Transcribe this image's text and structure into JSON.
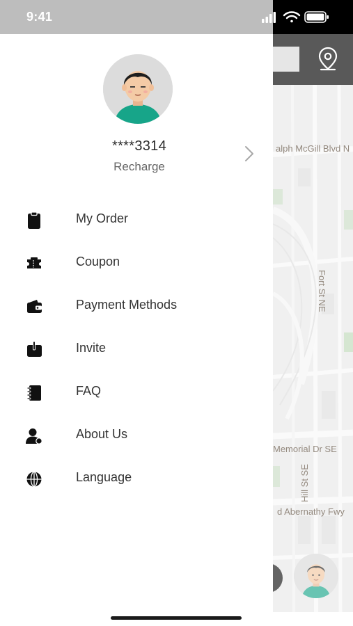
{
  "status_bar": {
    "time": "9:41"
  },
  "profile": {
    "phone_masked": "****3314",
    "recharge_label": "Recharge"
  },
  "menu": [
    {
      "label": "My Order",
      "icon": "clipboard-icon"
    },
    {
      "label": "Coupon",
      "icon": "coupon-icon"
    },
    {
      "label": "Payment Methods",
      "icon": "wallet-icon"
    },
    {
      "label": "Invite",
      "icon": "invite-icon"
    },
    {
      "label": "FAQ",
      "icon": "notebook-icon"
    },
    {
      "label": "About Us",
      "icon": "user-icon"
    },
    {
      "label": "Language",
      "icon": "globe-icon"
    }
  ],
  "map": {
    "street_labels": [
      "alph McGill Blvd N",
      "Fort St NE",
      "Memorial Dr SE",
      "Hill St SE",
      "d Abernathy Fwy"
    ]
  },
  "colors": {
    "status_bar_drawer": "#bdbdbd",
    "map_topbar": "#000000",
    "avatar_shirt": "#17a589",
    "text_primary": "#333333",
    "text_secondary": "#666666"
  }
}
